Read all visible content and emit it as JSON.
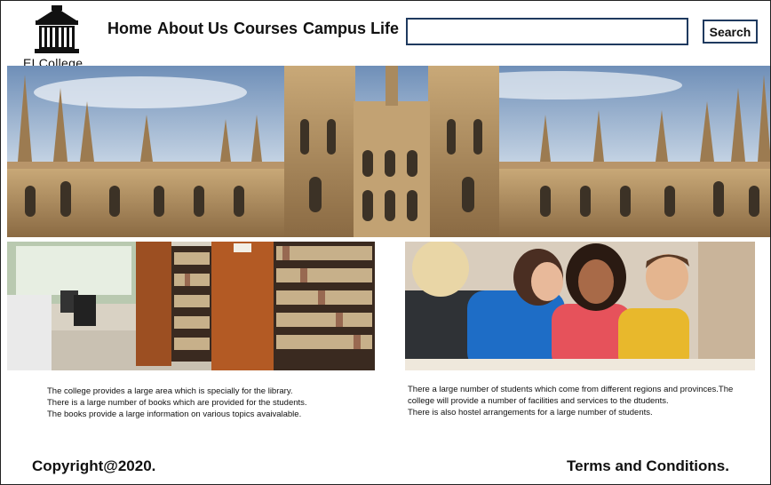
{
  "brand": {
    "name": "ELCollege",
    "icon": "college-building-icon"
  },
  "nav": {
    "items": [
      {
        "label": "Home"
      },
      {
        "label": "About Us"
      },
      {
        "label": "Courses"
      },
      {
        "label": "Campus Life"
      }
    ]
  },
  "search": {
    "value": "",
    "placeholder": "",
    "button_label": "Search"
  },
  "sections": {
    "library": {
      "image": "library-bookshelves-photo",
      "lines": [
        "The college provides a large area which is specially for the library.",
        "There is a large number of books which are provided for the students.",
        "The books provide a large information on various topics avaivalable."
      ]
    },
    "students": {
      "image": "students-studying-photo",
      "lines": [
        "There a large number of students which come from different regions and provinces.The college will provide a number of facilities and services to the dtudents.",
        "There is also hostel arrangements for a large number of students."
      ]
    }
  },
  "footer": {
    "copyright": "Copyright@2020.",
    "terms": "Terms and Conditions."
  },
  "colors": {
    "search_border": "#1f3a5f",
    "text": "#111111",
    "frame": "#222222"
  }
}
